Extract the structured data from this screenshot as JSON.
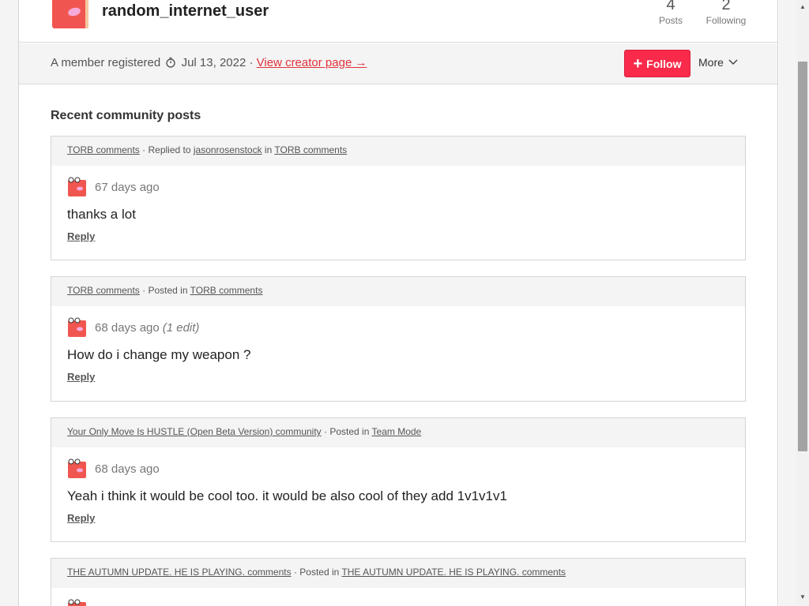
{
  "profile": {
    "username": "random_internet_user",
    "stats": [
      {
        "num": "4",
        "label": "Posts"
      },
      {
        "num": "2",
        "label": "Following"
      }
    ]
  },
  "meta": {
    "registered_prefix": "A member registered",
    "registered_date": "Jul 13, 2022",
    "separator": "·",
    "creator_link": "View creator page →",
    "follow_label": "Follow",
    "more_label": "More"
  },
  "section_title": "Recent community posts",
  "posts": [
    {
      "head_link1": "TORB comments",
      "head_mid": " · Replied to ",
      "head_link2": "jasonrosenstock",
      "head_mid2": " in ",
      "head_link3": "TORB comments",
      "time": "67 days ago",
      "edit": "",
      "text": "thanks a lot",
      "reply": "Reply"
    },
    {
      "head_link1": "TORB comments",
      "head_mid": " · Posted in ",
      "head_link2": "TORB comments",
      "time": "68 days ago",
      "edit": "(1 edit)",
      "text": "How do i change my weapon ?",
      "reply": "Reply"
    },
    {
      "head_link1": "Your Only Move Is HUSTLE (Open Beta Version) community",
      "head_mid": " · Posted in ",
      "head_link2": "Team Mode",
      "time": "68 days ago",
      "edit": "",
      "text": "Yeah i think it would be cool too. it would be also cool of they add 1v1v1v1",
      "reply": "Reply"
    },
    {
      "head_link1": "THE AUTUMN UPDATE. HE IS PLAYING. comments",
      "head_mid": " · Posted in ",
      "head_link2": "THE AUTUMN UPDATE. HE IS PLAYING. comments"
    }
  ],
  "colors": {
    "accent": "#fa2a4a",
    "link_red": "#e0323c",
    "avatar": "#f0564f"
  }
}
